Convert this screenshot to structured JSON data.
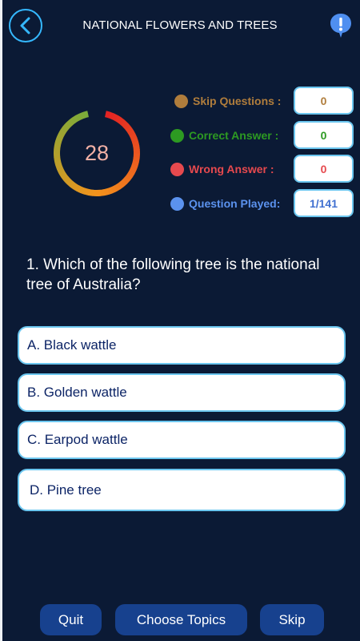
{
  "header": {
    "title": "NATIONAL FLOWERS AND TREES",
    "back_icon": "chevron-left-icon",
    "info_icon": "exclamation-bubble-icon"
  },
  "timer": {
    "value": "28",
    "remaining_fraction": 0.93,
    "colors": [
      "#e32323",
      "#f3931c",
      "#7bab3a"
    ]
  },
  "stats": [
    {
      "label": "Skip Questions :",
      "value": "0",
      "color": "#b07d3c",
      "value_color": "#b07d3c"
    },
    {
      "label": "Correct Answer :",
      "value": "0",
      "color": "#2d9a22",
      "value_color": "#2d9a22"
    },
    {
      "label": "Wrong Answer :",
      "value": "0",
      "color": "#e6494e",
      "value_color": "#e6494e"
    },
    {
      "label": "Question Played:",
      "value": "1/141",
      "color": "#5b92ee",
      "value_color": "#3f6fd0"
    }
  ],
  "question": {
    "text": "1.  Which of the following tree is the national tree of Australia?"
  },
  "options": [
    {
      "label": "A. Black wattle"
    },
    {
      "label": "B. Golden wattle"
    },
    {
      "label": "C. Earpod wattle"
    },
    {
      "label": "D. Pine tree"
    }
  ],
  "buttons": {
    "quit": "Quit",
    "choose_topics": "Choose Topics",
    "skip": "Skip"
  }
}
